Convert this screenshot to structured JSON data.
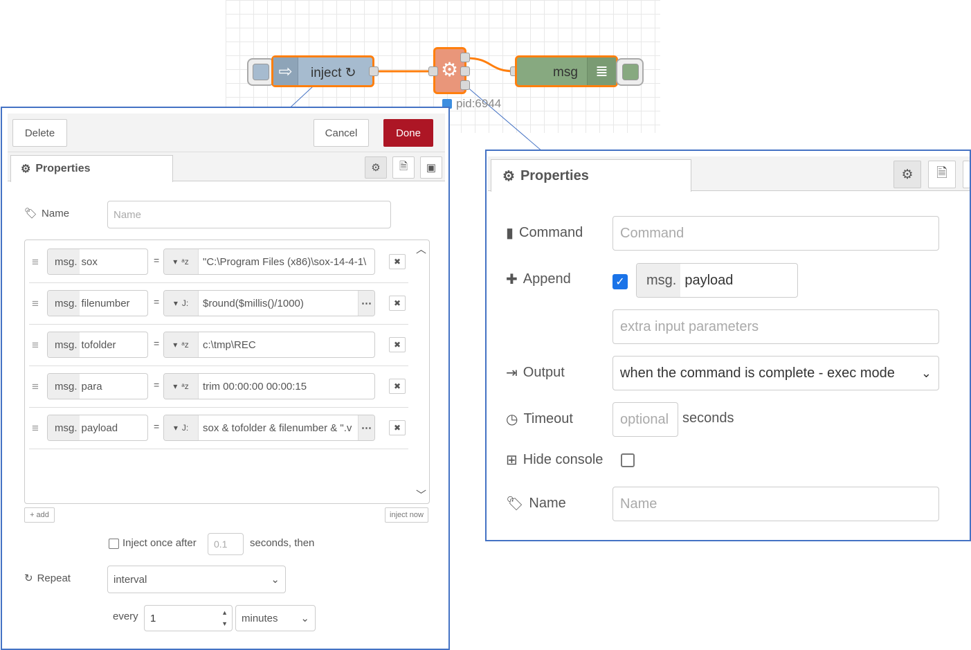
{
  "flow": {
    "inject_node_label": "inject ↻",
    "exec_node_status": "pid:6944",
    "debug_node_label": "msg"
  },
  "inject_editor": {
    "delete_label": "Delete",
    "cancel_label": "Cancel",
    "done_label": "Done",
    "tab_label": "Properties",
    "name_label": "Name",
    "name_placeholder": "Name",
    "rows": [
      {
        "prefix": "msg.",
        "prop": "sox",
        "type_icon": "ᵃz",
        "value": "\"C:\\Program Files (x86)\\sox-14-4-1\\",
        "more": false
      },
      {
        "prefix": "msg.",
        "prop": "filenumber",
        "type_icon": "J:",
        "value": "$round($millis()/1000)",
        "more": true
      },
      {
        "prefix": "msg.",
        "prop": "tofolder",
        "type_icon": "ᵃz",
        "value": "c:\\tmp\\REC",
        "more": false
      },
      {
        "prefix": "msg.",
        "prop": "para",
        "type_icon": "ᵃz",
        "value": " trim 00:00:00 00:00:15",
        "more": false
      },
      {
        "prefix": "msg.",
        "prop": "payload",
        "type_icon": "J:",
        "value": "sox & tofolder & filenumber & \".v",
        "more": true
      }
    ],
    "add_label": "+ add",
    "inject_now_label": "inject now",
    "inject_once_label": "Inject once after",
    "inject_once_value": "0.1",
    "seconds_then_label": "seconds, then",
    "repeat_label": "Repeat",
    "repeat_value": "interval",
    "every_label": "every",
    "every_value": "1",
    "unit_value": "minutes"
  },
  "exec_editor": {
    "tab_label": "Properties",
    "command_label": "Command",
    "command_placeholder": "Command",
    "append_label": "Append",
    "append_checked": true,
    "append_prefix": "msg.",
    "append_value": "payload",
    "extra_placeholder": "extra input parameters",
    "output_label": "Output",
    "output_value": "when the command is complete - exec mode",
    "timeout_label": "Timeout",
    "timeout_placeholder": "optional",
    "seconds_label": "seconds",
    "hide_console_label": "Hide console",
    "name_label": "Name",
    "name_placeholder": "Name"
  },
  "colors": {
    "accent_border": "#4472c4",
    "done_button": "#ad1625",
    "selected_node_border": "#ff7f0e",
    "inject_node": "#a6bbcf",
    "exec_node": "#e9967a",
    "debug_node": "#87a980",
    "checkbox_checked": "#1a73e8"
  }
}
